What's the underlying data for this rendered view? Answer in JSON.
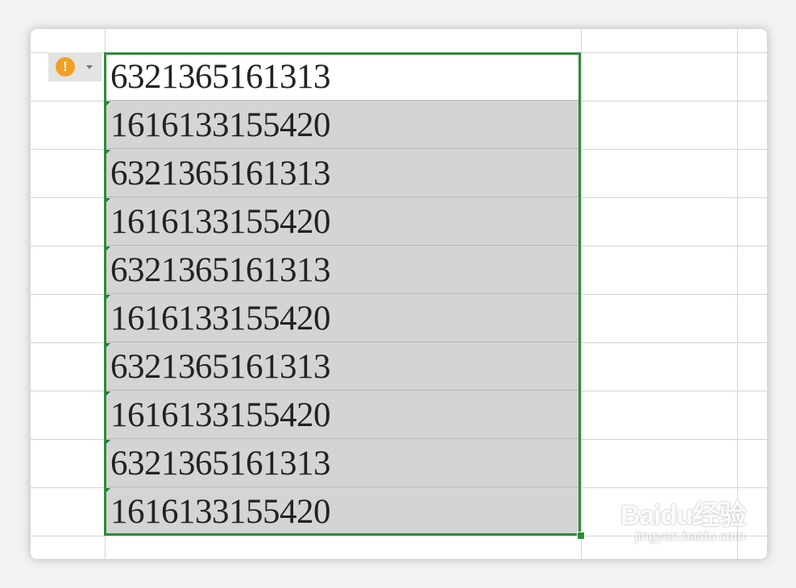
{
  "sheet": {
    "cells": [
      {
        "value": "6321365161313",
        "selected": false
      },
      {
        "value": "1616133155420",
        "selected": true
      },
      {
        "value": "6321365161313",
        "selected": true
      },
      {
        "value": "1616133155420",
        "selected": true
      },
      {
        "value": "6321365161313",
        "selected": true
      },
      {
        "value": "1616133155420",
        "selected": true
      },
      {
        "value": "6321365161313",
        "selected": true
      },
      {
        "value": "1616133155420",
        "selected": true
      },
      {
        "value": "6321365161313",
        "selected": true
      },
      {
        "value": "1616133155420",
        "selected": true
      }
    ]
  },
  "error_indicator": {
    "icon": "warning-icon",
    "glyph": "!",
    "color": "#f0a024"
  },
  "selection": {
    "color": "#2e8b3a"
  },
  "watermark": {
    "logo": "Baidu经验",
    "url": "jingyan.baidu.com"
  }
}
